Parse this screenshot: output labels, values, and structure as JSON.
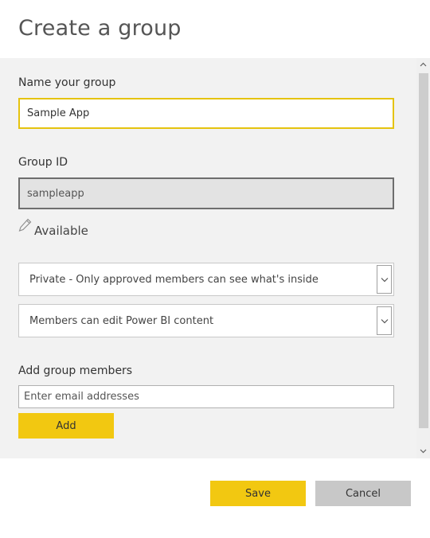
{
  "dialog": {
    "title": "Create a group"
  },
  "form": {
    "name_label": "Name your group",
    "name_value": "Sample App",
    "id_label": "Group ID",
    "id_value": "sampleapp",
    "availability_text": "Available",
    "privacy_select": {
      "selected": "Private - Only approved members can see what's inside"
    },
    "permission_select": {
      "selected": "Members can edit Power BI content"
    },
    "members_label": "Add group members",
    "email_placeholder": "Enter email addresses",
    "add_label": "Add"
  },
  "footer": {
    "save_label": "Save",
    "cancel_label": "Cancel"
  },
  "colors": {
    "accent": "#f2c811",
    "focus_border": "#e5c30f",
    "panel_bg": "#f2f2f2",
    "cancel_bg": "#c8c8c8"
  },
  "icons": [
    "pencil-icon",
    "chevron-down-icon",
    "scroll-up-arrow-icon",
    "scroll-down-arrow-icon"
  ]
}
